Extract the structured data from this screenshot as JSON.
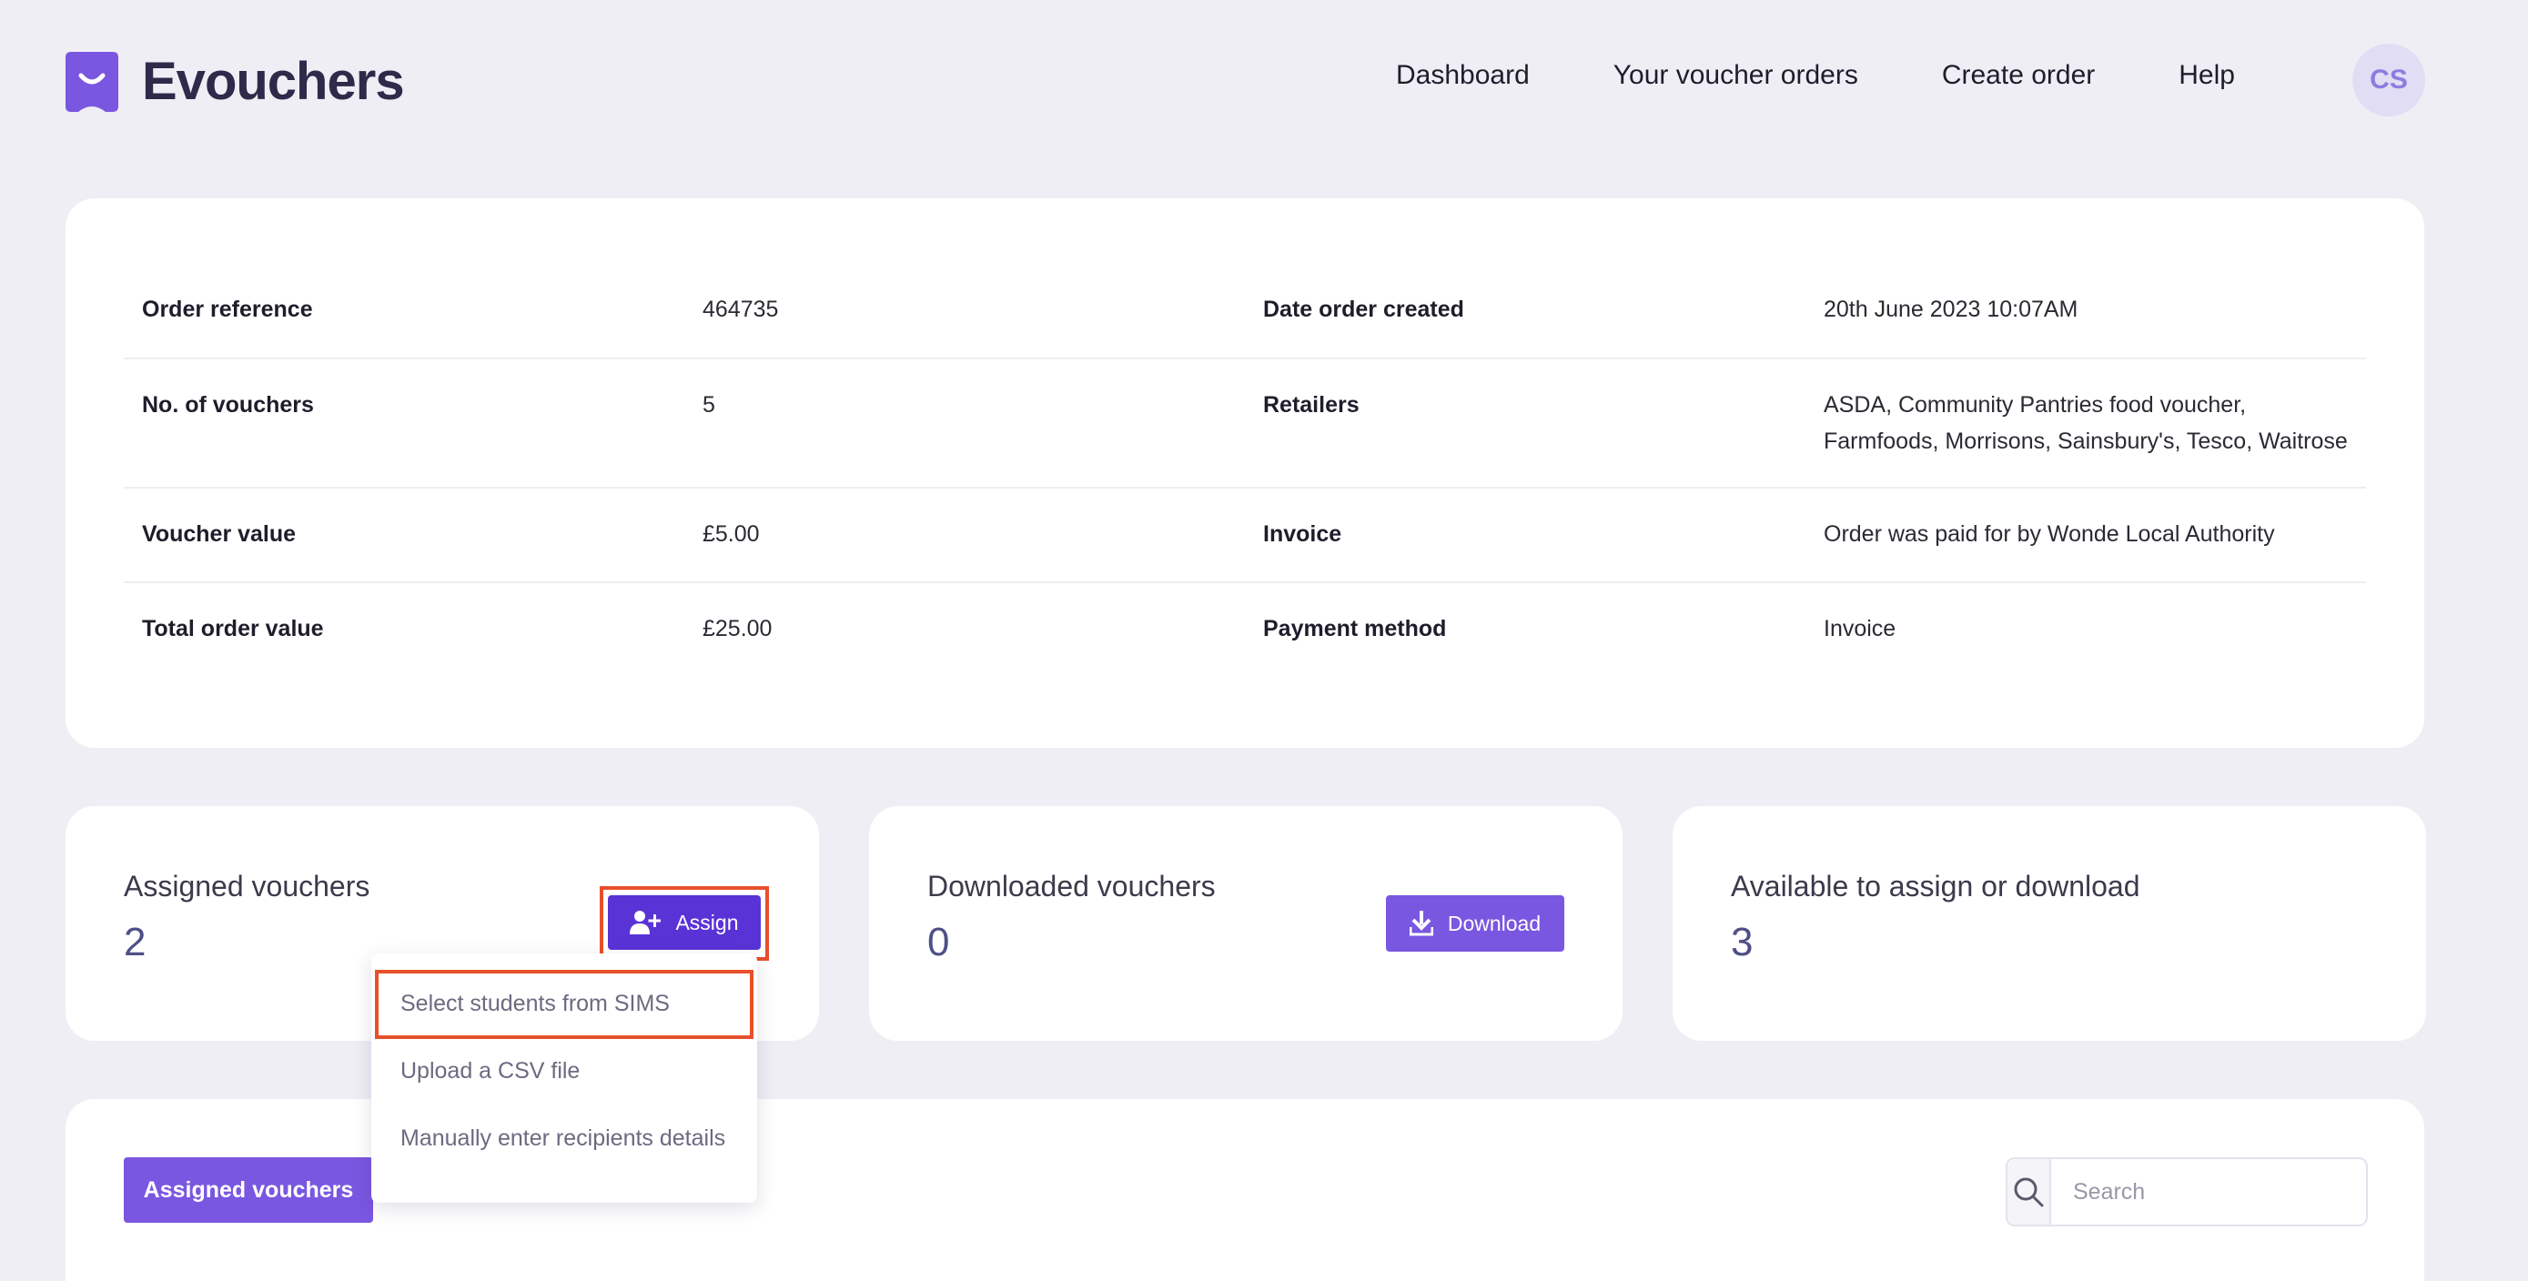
{
  "app": {
    "name": "Evouchers",
    "accent": "#7a57e0",
    "brand_dark": "#2f2a4a"
  },
  "nav": {
    "items": [
      {
        "label": "Dashboard"
      },
      {
        "label": "Your voucher orders"
      },
      {
        "label": "Create order"
      },
      {
        "label": "Help"
      }
    ],
    "avatar_initials": "CS"
  },
  "order": {
    "rows": [
      {
        "label_left": "Order reference",
        "value_left": "464735",
        "label_right": "Date order created",
        "value_right": "20th June 2023 10:07AM"
      },
      {
        "label_left": "No. of vouchers",
        "value_left": "5",
        "label_right": "Retailers",
        "value_right_line1": "ASDA, Community Pantries food voucher,",
        "value_right_line2": "Farmfoods, Morrisons, Sainsbury's, Tesco, Waitrose"
      },
      {
        "label_left": "Voucher value",
        "value_left": "£5.00",
        "label_right": "Invoice",
        "value_right": "Order was paid for by Wonde Local Authority"
      },
      {
        "label_left": "Total order value",
        "value_left": "£25.00",
        "label_right": "Payment method",
        "value_right": "Invoice"
      }
    ]
  },
  "stats": {
    "assigned": {
      "title": "Assigned vouchers",
      "value": "2",
      "button": "Assign"
    },
    "downloaded": {
      "title": "Downloaded vouchers",
      "value": "0",
      "button": "Download"
    },
    "available": {
      "title": "Available to assign or download",
      "value": "3"
    }
  },
  "assign_menu": {
    "items": [
      {
        "label": "Select students from SIMS"
      },
      {
        "label": "Upload a CSV file"
      },
      {
        "label": "Manually enter recipients details"
      }
    ]
  },
  "list": {
    "active_tab": "Assigned vouchers",
    "search_placeholder": "Search"
  },
  "icons": {
    "logo": "evouchers-logo-icon",
    "assign": "user-plus-icon",
    "download": "download-icon",
    "search": "search-icon"
  },
  "highlight_color": "#e8502b"
}
